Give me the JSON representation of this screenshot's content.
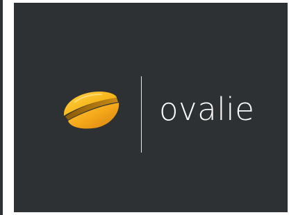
{
  "brand": {
    "name": "ovalie",
    "icon": "ovalie-logo-icon"
  },
  "colors": {
    "background": "#2d3133",
    "logo_yellow": "#f7b619",
    "logo_orange": "#e8951a",
    "text": "#ffffff",
    "divider": "#e8e8e8"
  }
}
